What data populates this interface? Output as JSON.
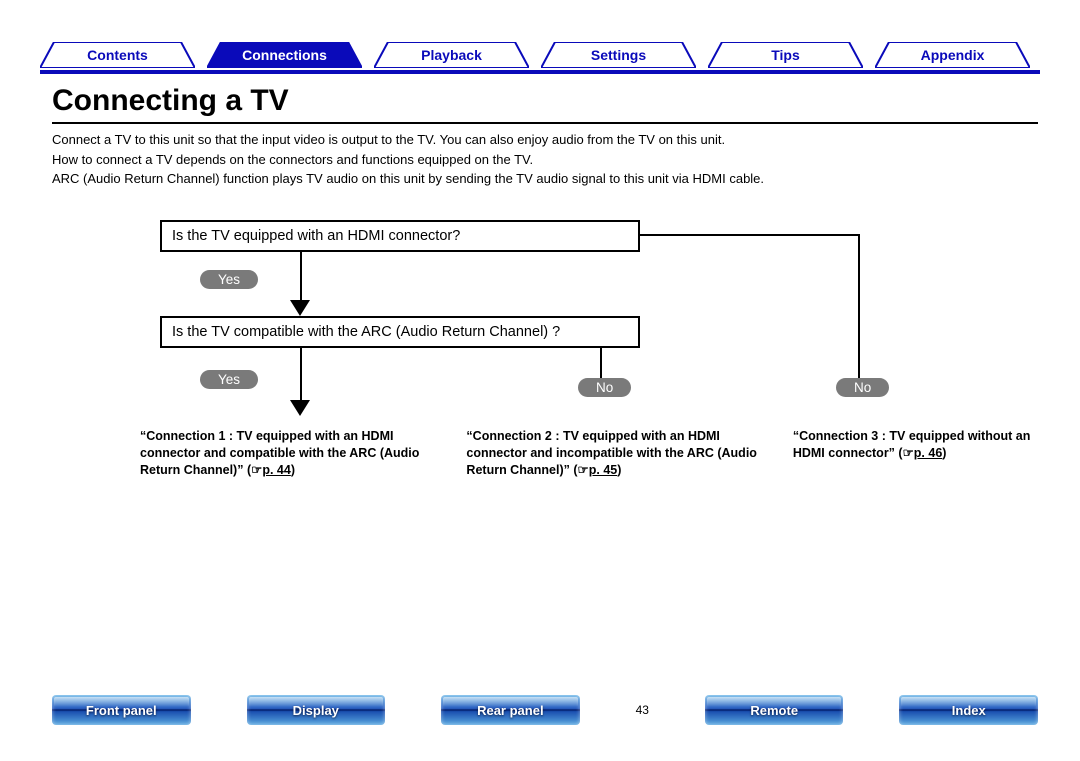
{
  "tabs": [
    "Contents",
    "Connections",
    "Playback",
    "Settings",
    "Tips",
    "Appendix"
  ],
  "active_tab_index": 1,
  "page_title": "Connecting a TV",
  "intro": [
    "Connect a TV to this unit so that the input video is output to the TV. You can also enjoy audio from the TV on this unit.",
    "How to connect a TV depends on the connectors and functions equipped on the TV.",
    "ARC (Audio Return Channel) function plays TV audio on this unit by sending the TV audio signal to this unit via HDMI cable."
  ],
  "flow": {
    "q1": "Is the TV equipped with an HDMI connector?",
    "q2": "Is the TV compatible with the ARC (Audio Return Channel) ?",
    "yes": "Yes",
    "no": "No"
  },
  "connections": [
    {
      "text": "“Connection 1 : TV equipped with an HDMI connector and compatible with the ARC (Audio Return Channel)” (☞",
      "ref": "p. 44",
      "suffix": ")"
    },
    {
      "text": "“Connection 2 : TV equipped with an HDMI connector and incompatible with the ARC (Audio Return Channel)” (☞",
      "ref": "p. 45",
      "suffix": ")"
    },
    {
      "text": "“Connection 3 : TV equipped without an HDMI connector” (☞",
      "ref": "p. 46",
      "suffix": ")"
    }
  ],
  "bottom_nav": [
    "Front panel",
    "Display",
    "Rear panel",
    "Remote",
    "Index"
  ],
  "page_number": "43"
}
